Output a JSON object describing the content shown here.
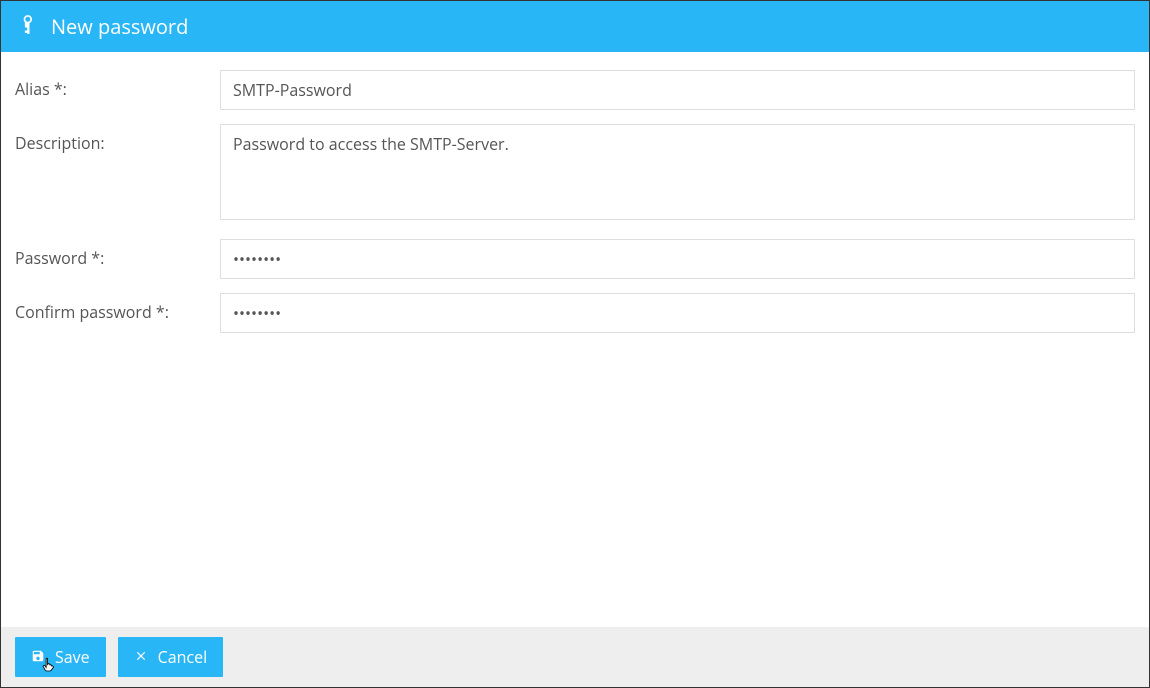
{
  "header": {
    "title": "New password"
  },
  "form": {
    "alias": {
      "label": "Alias *:",
      "value": "SMTP-Password"
    },
    "description": {
      "label": "Description:",
      "value": "Password to access the SMTP-Server."
    },
    "password": {
      "label": "Password *:",
      "value": "••••••••"
    },
    "confirm": {
      "label": "Confirm password *:",
      "value": "••••••••"
    }
  },
  "footer": {
    "save_label": "Save",
    "cancel_label": "Cancel"
  }
}
